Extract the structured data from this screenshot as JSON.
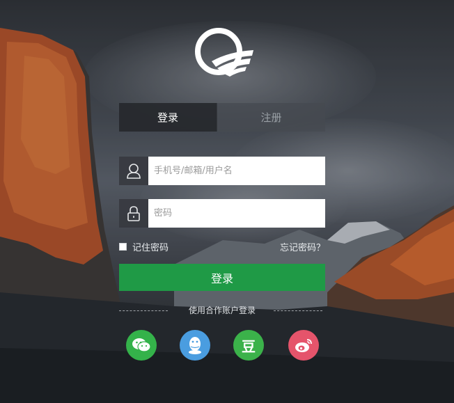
{
  "tabs": {
    "login_label": "登录",
    "register_label": "注册"
  },
  "form": {
    "account_placeholder": "手机号/邮箱/用户名",
    "password_placeholder": "密码",
    "remember_label": "记住密码",
    "forgot_label": "忘记密码？",
    "submit_label": "登录"
  },
  "social": {
    "divider_text": "使用合作账户登录",
    "providers": [
      {
        "icon": "wechat-icon",
        "color": "#34b24a"
      },
      {
        "icon": "qq-icon",
        "color": "#4a9de0"
      },
      {
        "icon": "douban-icon",
        "color": "#3bb24a",
        "glyph": "豆"
      },
      {
        "icon": "weibo-icon",
        "color": "#e5546b"
      }
    ]
  },
  "colors": {
    "primary_button": "#1f9a46"
  }
}
